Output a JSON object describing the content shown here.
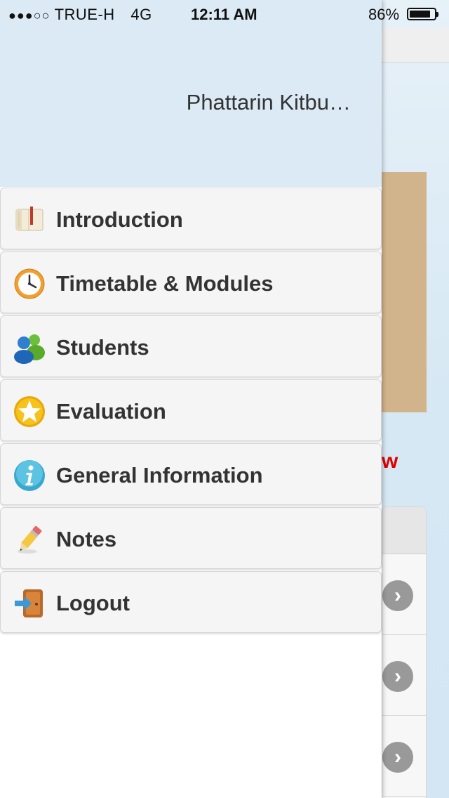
{
  "status_bar": {
    "signal_dots": "●●●○○",
    "carrier": "TRUE-H",
    "network": "4G",
    "time": "12:11 AM",
    "battery_percent": "86%",
    "battery_level": 0.86
  },
  "drawer": {
    "user_name": "Phattarin Kitbu…",
    "items": [
      {
        "label": "Introduction",
        "icon": "book-icon"
      },
      {
        "label": "Timetable & Modules",
        "icon": "clock-icon"
      },
      {
        "label": "Students",
        "icon": "users-icon"
      },
      {
        "label": "Evaluation",
        "icon": "star-icon"
      },
      {
        "label": "General Information",
        "icon": "info-icon"
      },
      {
        "label": "Notes",
        "icon": "pencil-icon"
      },
      {
        "label": "Logout",
        "icon": "logout-door-icon"
      }
    ]
  },
  "background": {
    "partial_red_text": "w",
    "chevron_glyph": "›"
  },
  "colors": {
    "drawer_header": "#dbeaf5",
    "menu_item_bg": "#f5f5f5",
    "banner": "#d2b48c",
    "red_text": "#e00000"
  }
}
